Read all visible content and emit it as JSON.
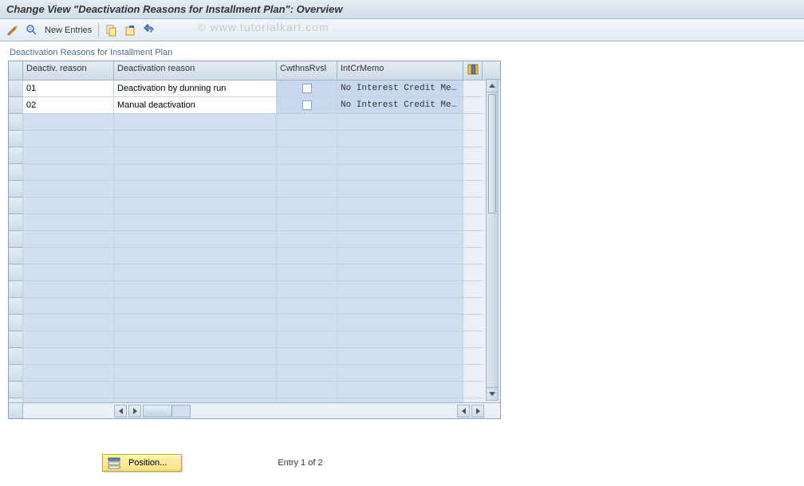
{
  "title": "Change View \"Deactivation Reasons for Installment Plan\": Overview",
  "watermark": "www.tutorialkart.com",
  "toolbar": {
    "new_entries_label": "New Entries"
  },
  "group_title": "Deactivation Reasons for Installment Plan",
  "columns": {
    "c1": "Deactiv. reason",
    "c2": "Deactivation reason",
    "c3": "CwthnsRvsl",
    "c4": "IntCrMemo"
  },
  "rows": [
    {
      "code": "01",
      "text": "Deactivation by dunning run",
      "cwthnsRvsl": false,
      "intCrMemo": "No Interest Credit Me…"
    },
    {
      "code": "02",
      "text": "Manual deactivation",
      "cwthnsRvsl": false,
      "intCrMemo": "No Interest Credit Me…"
    }
  ],
  "empty_row_count": 18,
  "footer": {
    "position_label": "Position...",
    "status": "Entry 1 of 2"
  }
}
